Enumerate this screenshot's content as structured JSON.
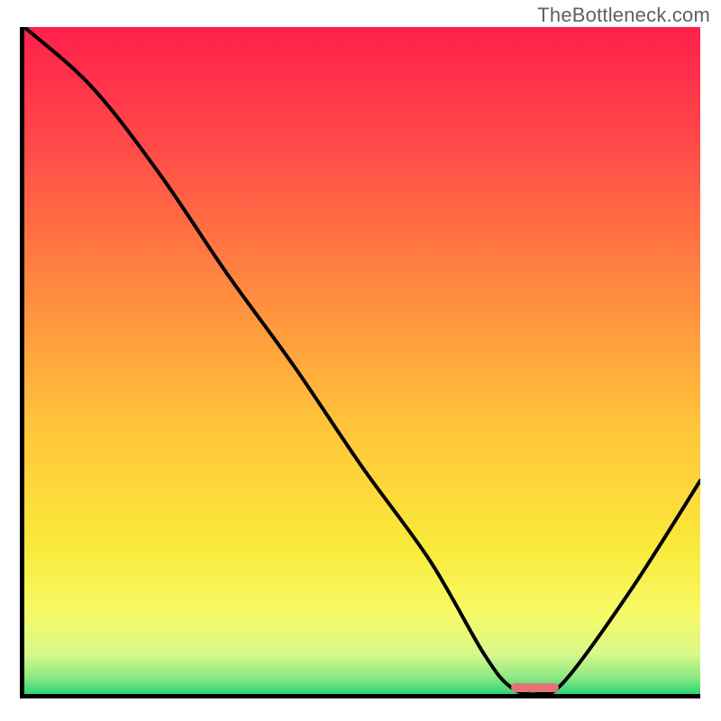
{
  "watermark": "TheBottleneck.com",
  "chart_data": {
    "type": "line",
    "title": "",
    "xlabel": "",
    "ylabel": "",
    "xlim": [
      0,
      100
    ],
    "ylim": [
      0,
      100
    ],
    "note": "Axes have no visible tick labels. x is interpreted as horizontal position percent (0=left axis, 100=right edge). y is bottleneck percent (0=optimal/bottom, 100=severe/top). Values estimated from curve geometry.",
    "series": [
      {
        "name": "bottleneck-curve",
        "x": [
          0,
          10,
          20,
          30,
          40,
          50,
          60,
          68,
          72,
          76,
          80,
          90,
          100
        ],
        "y": [
          100,
          91,
          78,
          63,
          49,
          34,
          20,
          6,
          1,
          0,
          2,
          16,
          32
        ]
      }
    ],
    "optimal_zone": {
      "x_start": 72,
      "x_end": 79
    },
    "background_gradient": {
      "description": "vertical gradient representing bottleneck severity, red at top (bad) to green at bottom (good)",
      "stops": [
        {
          "offset": 0.0,
          "color": "#ff1f4b"
        },
        {
          "offset": 0.18,
          "color": "#ff4b49"
        },
        {
          "offset": 0.4,
          "color": "#ff8b3f"
        },
        {
          "offset": 0.6,
          "color": "#ffc53a"
        },
        {
          "offset": 0.78,
          "color": "#f9ea3a"
        },
        {
          "offset": 0.88,
          "color": "#f6fa66"
        },
        {
          "offset": 0.94,
          "color": "#d8f88a"
        },
        {
          "offset": 0.975,
          "color": "#8de882"
        },
        {
          "offset": 1.0,
          "color": "#2fd576"
        }
      ]
    },
    "curve_color": "#000000",
    "marker_color": "#e57373"
  }
}
